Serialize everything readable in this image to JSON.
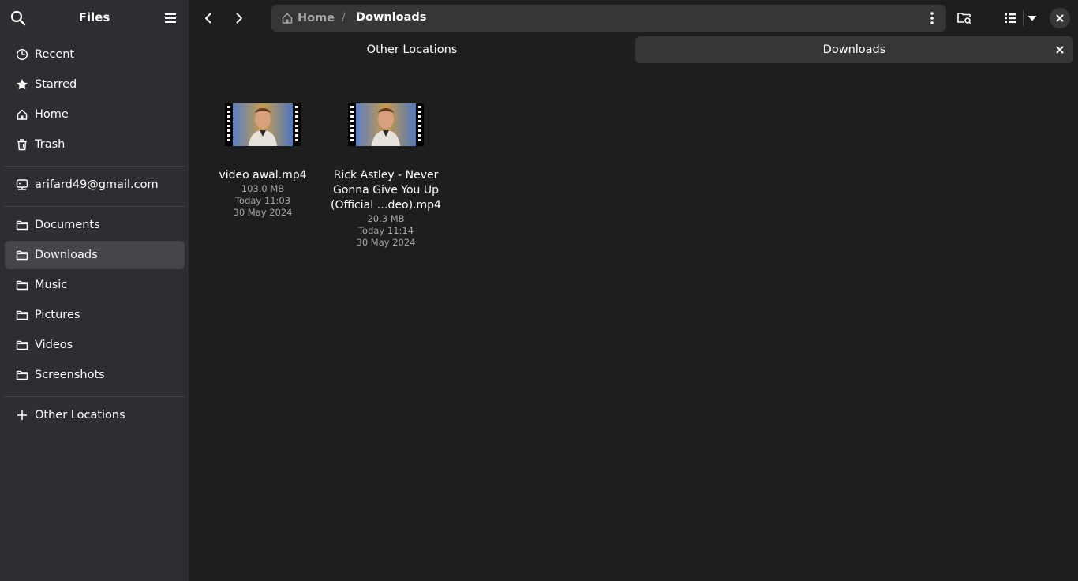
{
  "sidebar": {
    "title": "Files",
    "places": [
      {
        "label": "Recent",
        "icon": "clock-icon"
      },
      {
        "label": "Starred",
        "icon": "star-icon"
      },
      {
        "label": "Home",
        "icon": "home-icon"
      },
      {
        "label": "Trash",
        "icon": "trash-icon"
      }
    ],
    "account": {
      "label": "arifard49@gmail.com",
      "icon": "network-drive-icon"
    },
    "bookmarks": [
      {
        "label": "Documents",
        "icon": "folder-icon"
      },
      {
        "label": "Downloads",
        "icon": "folder-icon",
        "active": true
      },
      {
        "label": "Music",
        "icon": "folder-icon"
      },
      {
        "label": "Pictures",
        "icon": "folder-icon"
      },
      {
        "label": "Videos",
        "icon": "folder-icon"
      },
      {
        "label": "Screenshots",
        "icon": "folder-icon"
      }
    ],
    "other": {
      "label": "Other Locations",
      "icon": "plus-icon"
    }
  },
  "pathbar": {
    "home_label": "Home",
    "separator": "/",
    "current": "Downloads"
  },
  "tabs": [
    {
      "label": "Other Locations",
      "active": false
    },
    {
      "label": "Downloads",
      "active": true
    }
  ],
  "files": [
    {
      "name": "video awal.mp4",
      "size": "103.0 MB",
      "time": "Today 11:03",
      "date": "30 May 2024"
    },
    {
      "name": "Rick Astley - Never Gonna Give You Up (Official …deo).mp4",
      "size": "20.3 MB",
      "time": "Today 11:14",
      "date": "30 May 2024"
    }
  ],
  "colors": {
    "sidebar_bg": "#2e2e32",
    "content_bg": "#1e1e1e",
    "active_item": "#46464a",
    "pathbar_bg": "#363639"
  }
}
